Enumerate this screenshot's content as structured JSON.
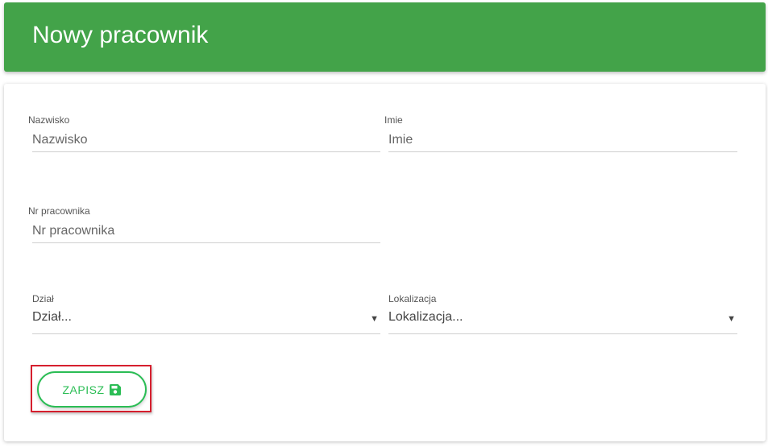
{
  "header": {
    "title": "Nowy pracownik"
  },
  "form": {
    "surname": {
      "label": "Nazwisko",
      "placeholder": "Nazwisko"
    },
    "first_name": {
      "label": "Imie",
      "placeholder": "Imie"
    },
    "employee_number": {
      "label": "Nr pracownika",
      "placeholder": "Nr pracownika"
    },
    "department": {
      "label": "Dział",
      "value": "Dział...",
      "arrow": "▼"
    },
    "location": {
      "label": "Lokalizacja",
      "value": "Lokalizacja...",
      "arrow": "▼"
    },
    "save_button": {
      "label": "ZAPISZ",
      "icon": "save-icon"
    }
  },
  "colors": {
    "header_green": "#43a349",
    "button_green": "#2bbd55",
    "highlight_red": "#d61f2e"
  }
}
